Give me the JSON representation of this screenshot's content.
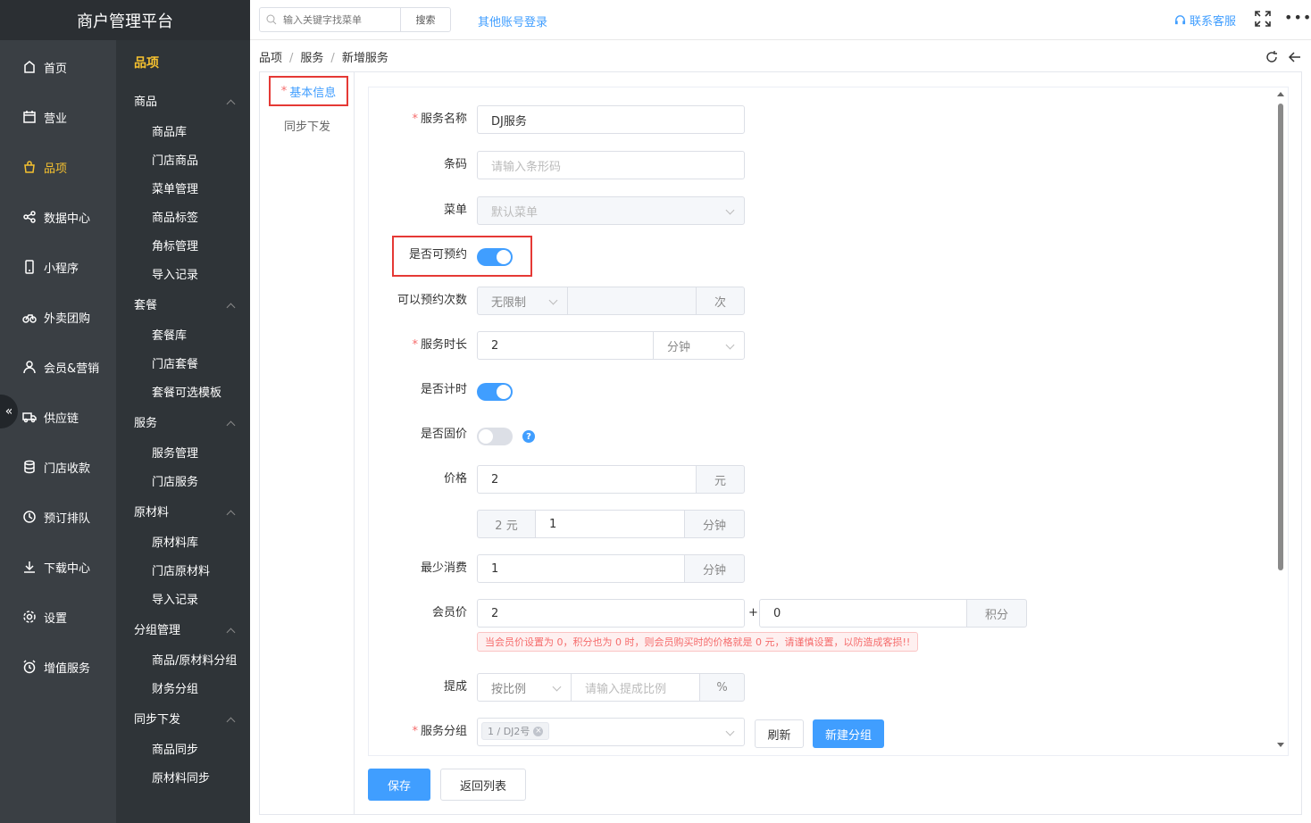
{
  "app": {
    "title": "商户管理平台"
  },
  "nav1": {
    "items": [
      {
        "label": "首页",
        "icon": "home-icon"
      },
      {
        "label": "营业",
        "icon": "calendar-icon"
      },
      {
        "label": "品项",
        "icon": "bag-icon"
      },
      {
        "label": "数据中心",
        "icon": "share-icon"
      },
      {
        "label": "小程序",
        "icon": "phone-icon"
      },
      {
        "label": "外卖团购",
        "icon": "bike-icon"
      },
      {
        "label": "会员&营销",
        "icon": "user-icon"
      },
      {
        "label": "供应链",
        "icon": "truck-icon"
      },
      {
        "label": "门店收款",
        "icon": "database-icon"
      },
      {
        "label": "预订排队",
        "icon": "clock-icon"
      },
      {
        "label": "下载中心",
        "icon": "download-icon"
      },
      {
        "label": "设置",
        "icon": "gear-icon"
      },
      {
        "label": "增值服务",
        "icon": "alarm-icon"
      }
    ],
    "active": "品项"
  },
  "nav2": {
    "title": "品项",
    "groups": [
      {
        "label": "商品",
        "items": [
          "商品库",
          "门店商品",
          "菜单管理",
          "商品标签",
          "角标管理",
          "导入记录"
        ]
      },
      {
        "label": "套餐",
        "items": [
          "套餐库",
          "门店套餐",
          "套餐可选模板"
        ]
      },
      {
        "label": "服务",
        "items": [
          "服务管理",
          "门店服务"
        ]
      },
      {
        "label": "原材料",
        "items": [
          "原材料库",
          "门店原材料",
          "导入记录"
        ]
      },
      {
        "label": "分组管理",
        "items": [
          "商品/原材料分组",
          "财务分组"
        ]
      },
      {
        "label": "同步下发",
        "items": [
          "商品同步",
          "原材料同步"
        ]
      }
    ]
  },
  "topbar": {
    "search_placeholder": "输入关键字找菜单",
    "search_button": "搜索",
    "other_login": "其他账号登录",
    "service": "联系客服",
    "more": "•••"
  },
  "breadcrumb": {
    "items": [
      "品项",
      "服务",
      "新增服务"
    ],
    "sep": "/"
  },
  "tabs": {
    "basic": "基本信息",
    "sync": "同步下发",
    "required_mark": "*"
  },
  "form": {
    "required_mark": "*",
    "name": {
      "label": "服务名称",
      "value": "DJ服务"
    },
    "barcode": {
      "label": "条码",
      "placeholder": "请输入条形码"
    },
    "menu": {
      "label": "菜单",
      "value": "默认菜单"
    },
    "bookable": {
      "label": "是否可预约",
      "on": true
    },
    "book_times": {
      "label": "可以预约次数",
      "select": "无限制",
      "suffix": "次"
    },
    "duration": {
      "label": "服务时长",
      "value": "2",
      "unit": "分钟"
    },
    "timing": {
      "label": "是否计时",
      "on": true
    },
    "fixed_price": {
      "label": "是否固价",
      "on": false,
      "help": "?"
    },
    "price": {
      "label": "价格",
      "value": "2",
      "unit": "元",
      "prefix2": "2 元",
      "value2": "1",
      "unit2": "分钟"
    },
    "min_spend": {
      "label": "最少消费",
      "value": "1",
      "unit": "分钟"
    },
    "member_price": {
      "label": "会员价",
      "value": "2",
      "plus": "+",
      "points": "0",
      "points_unit": "积分",
      "warning": "当会员价设置为 0，积分也为 0 时，则会员购买时的价格就是 0 元，请谨慎设置，以防造成客损!!"
    },
    "commission": {
      "label": "提成",
      "select": "按比例",
      "placeholder": "请输入提成比例",
      "unit": "%"
    },
    "group": {
      "label": "服务分组",
      "tag": "1 / DJ2号",
      "tag_close": "×",
      "refresh": "刷新",
      "new": "新建分组"
    }
  },
  "actions": {
    "save": "保存",
    "back": "返回列表"
  }
}
